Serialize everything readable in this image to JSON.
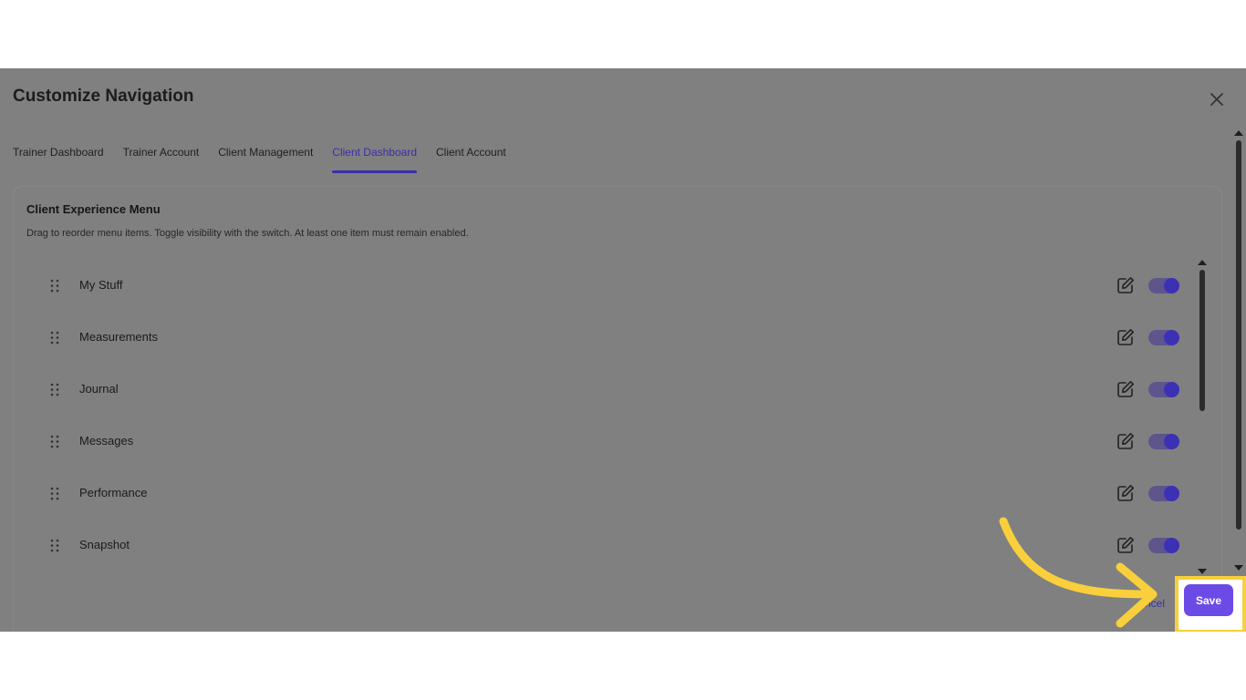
{
  "modal": {
    "title": "Customize Navigation",
    "close_icon": "close-icon"
  },
  "tabs": [
    {
      "label": "Trainer Dashboard",
      "active": false
    },
    {
      "label": "Trainer Account",
      "active": false
    },
    {
      "label": "Client Management",
      "active": false
    },
    {
      "label": "Client Dashboard",
      "active": true
    },
    {
      "label": "Client Account",
      "active": false
    }
  ],
  "panel": {
    "title": "Client Experience Menu",
    "description": "Drag to reorder menu items. Toggle visibility with the switch. At least one item must remain enabled."
  },
  "menu_items": [
    {
      "label": "My Stuff",
      "enabled": true
    },
    {
      "label": "Measurements",
      "enabled": true
    },
    {
      "label": "Journal",
      "enabled": true
    },
    {
      "label": "Messages",
      "enabled": true
    },
    {
      "label": "Performance",
      "enabled": true
    },
    {
      "label": "Snapshot",
      "enabled": true
    }
  ],
  "footer": {
    "cancel_label": "ncel",
    "save_label": "Save"
  },
  "colors": {
    "accent": "#3b2ea8",
    "save_button": "#6b4be6",
    "toggle_knob": "#3c31b4",
    "overlay": "#808080",
    "highlight": "#f9cf3b"
  },
  "icons": {
    "drag": "drag-handle-icon",
    "edit": "edit-icon",
    "close": "close-icon",
    "annotation_arrow": "arrow-annotation-icon"
  }
}
